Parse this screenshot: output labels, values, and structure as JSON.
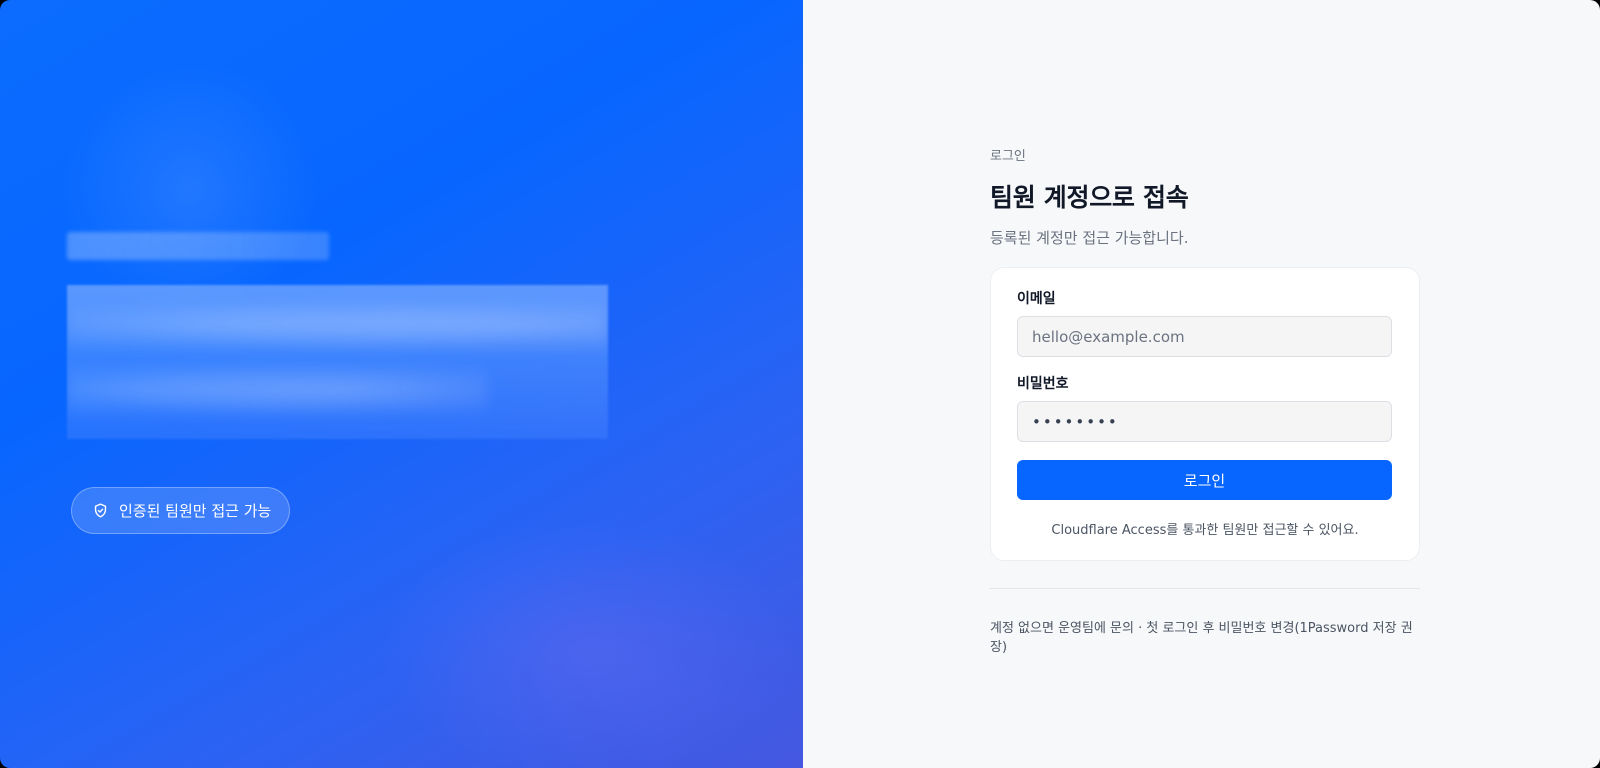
{
  "hero": {
    "badge_label": "인증된 팀원만 접근 가능",
    "badge_icon": "shield-check-icon"
  },
  "login": {
    "eyebrow": "로그인",
    "title": "팀원 계정으로 접속",
    "subtitle": "등록된 계정만 접근 가능합니다.",
    "email_label": "이메일",
    "email_placeholder": "hello@example.com",
    "password_label": "비밀번호",
    "password_value": "••••••••",
    "submit_label": "로그인",
    "card_note": "Cloudflare Access를 통과한 팀원만 접근할 수 있어요.",
    "footnote": "계정 없으면 운영팀에 문의 · 첫 로그인 후 비밀번호 변경(1Password 저장 권장)"
  },
  "colors": {
    "accent": "#0766ff",
    "panel_bg": "#f7f8fa"
  }
}
